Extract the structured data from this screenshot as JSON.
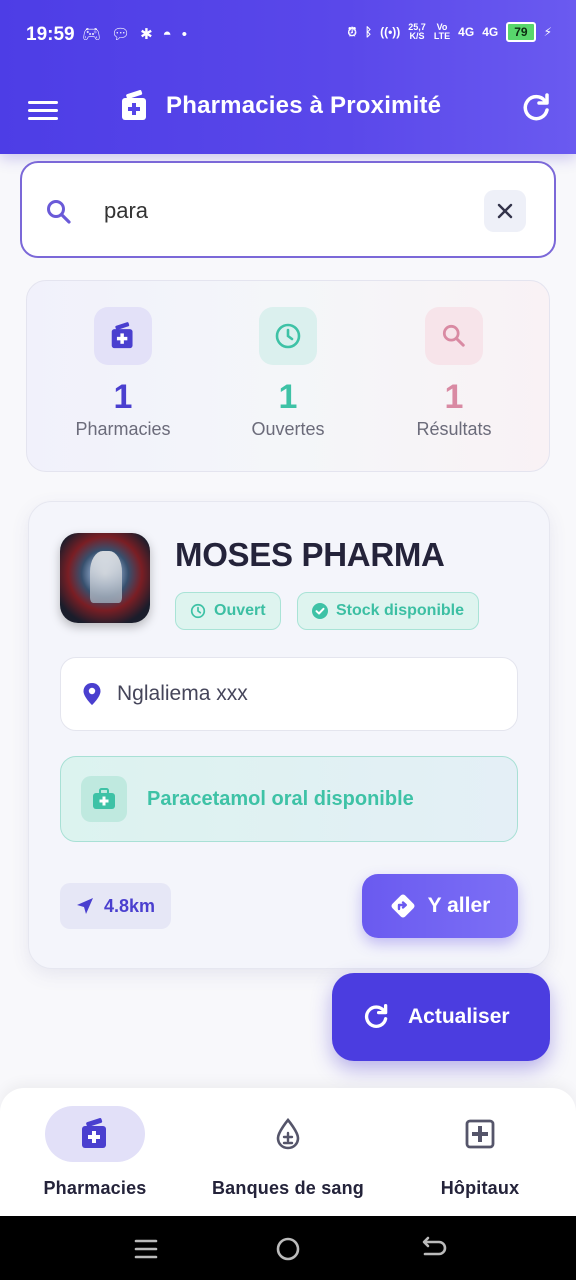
{
  "status_bar": {
    "time": "19:59",
    "net_speed_value": "25,7",
    "net_speed_unit": "K/S",
    "volte_top": "Vo",
    "volte_bottom": "LTE",
    "signal1": "4G",
    "signal2": "4G",
    "battery": "79"
  },
  "appbar": {
    "title": "Pharmacies à Proximité"
  },
  "search": {
    "value": "para",
    "placeholder": ""
  },
  "stats": {
    "pharmacies": {
      "value": "1",
      "label": "Pharmacies",
      "color": "#4a3fcf"
    },
    "open": {
      "value": "1",
      "label": "Ouvertes",
      "color": "#3ec2a6"
    },
    "results": {
      "value": "1",
      "label": "Résultats",
      "color": "#d98aa3"
    }
  },
  "pharmacy": {
    "name": "MOSES PHARMA",
    "status_badge": "Ouvert",
    "stock_badge": "Stock disponible",
    "address": "Nglaliema xxx",
    "medicine_availability": "Paracetamol oral disponible",
    "distance": "4.8km",
    "go_label": "Y aller"
  },
  "fab": {
    "label": "Actualiser"
  },
  "bottom_nav": {
    "items": [
      {
        "label": "Pharmacies",
        "active": true
      },
      {
        "label": "Banques de sang",
        "active": false
      },
      {
        "label": "Hôpitaux",
        "active": false
      }
    ]
  },
  "colors": {
    "primary": "#4b3de0",
    "accent_teal": "#3ec2a6",
    "accent_pink": "#d98aa3"
  }
}
